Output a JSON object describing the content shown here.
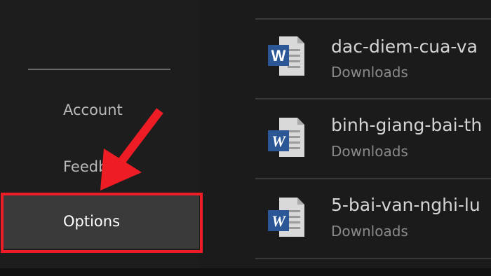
{
  "sidebar": {
    "items": [
      {
        "label": "Account"
      },
      {
        "label": "Feedb"
      },
      {
        "label": "Options"
      }
    ]
  },
  "files": [
    {
      "name": "dac-diem-cua-va",
      "location": "Downloads",
      "icon": "word-document-icon"
    },
    {
      "name": "binh-giang-bai-th",
      "location": "Downloads",
      "icon": "word-document-icon"
    },
    {
      "name": "5-bai-van-nghi-lu",
      "location": "Downloads",
      "icon": "word-document-icon"
    }
  ],
  "annotation": {
    "highlight_color": "#ee1c24",
    "arrow_color": "#ee1c24"
  },
  "colors": {
    "word_blue": "#2b5797",
    "selected_bg": "#3a3a3a"
  }
}
